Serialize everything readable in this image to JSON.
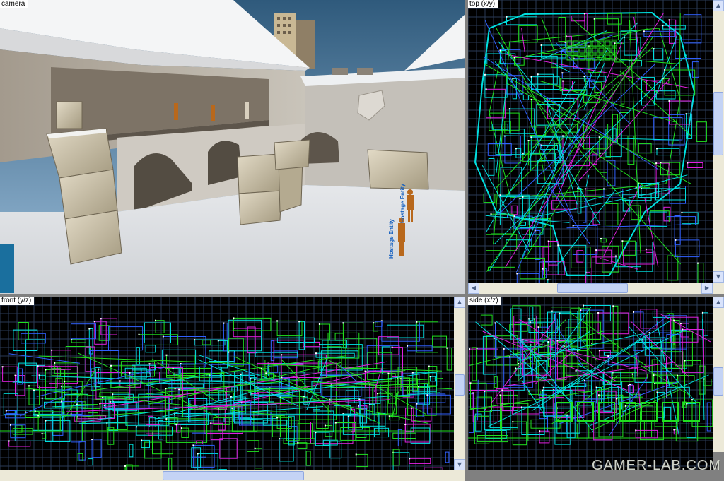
{
  "viewports": {
    "camera": {
      "label": "camera"
    },
    "top": {
      "label": "top (x/y)"
    },
    "front": {
      "label": "front (y/z)"
    },
    "side": {
      "label": "side (x/z)"
    }
  },
  "scene": {
    "entity_labels": [
      "Hostage Entity",
      "Hostage Entity"
    ]
  },
  "colors": {
    "background": "#000000",
    "grid": "#2a3a56",
    "brush_cyan": "#00e0e0",
    "brush_green": "#20e020",
    "brush_blue": "#3060ff",
    "brush_magenta": "#e020e0",
    "vertex_white": "#ffffff"
  },
  "watermark": "GAMER-LAB.COM"
}
